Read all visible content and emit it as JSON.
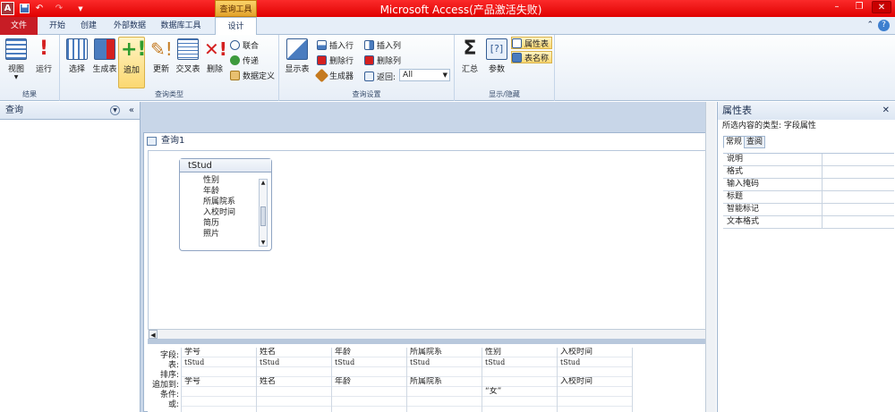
{
  "window": {
    "title": "Microsoft Access(产品激活失败)",
    "context_tab": "查询工具"
  },
  "quick_access": {
    "app_icon": "A",
    "save_icon": "save-icon",
    "undo_icon": "undo-icon",
    "redo_icon": "redo-icon",
    "more_icon": "chevron-down-icon"
  },
  "tabs": [
    {
      "label": "文件"
    },
    {
      "label": "开始"
    },
    {
      "label": "创建"
    },
    {
      "label": "外部数据"
    },
    {
      "label": "数据库工具"
    },
    {
      "label": "设计"
    }
  ],
  "ribbon": {
    "groups": {
      "results": "结果",
      "query_type": "查询类型",
      "query_setup": "查询设置",
      "show_hide": "显示/隐藏"
    },
    "buttons": {
      "view": "视图",
      "run": "运行",
      "select": "选择",
      "make_table": "生成表",
      "append": "追加",
      "update": "更新",
      "crosstab": "交叉表",
      "delete": "删除",
      "union": "联合",
      "pass_through": "传递",
      "data_definition": "数据定义",
      "show_table": "显示表",
      "insert_rows": "插入行",
      "delete_rows": "删除行",
      "builder": "生成器",
      "insert_columns": "插入列",
      "delete_columns": "删除列",
      "return_label": "返回:",
      "return_value": "All",
      "totals": "汇总",
      "parameters": "参数",
      "property_sheet": "属性表",
      "table_names": "表名称"
    }
  },
  "nav": {
    "title": "查询"
  },
  "query": {
    "tab_title": "查询1",
    "table": {
      "name": "tStud",
      "fields": [
        "性别",
        "年龄",
        "所属院系",
        "入校时间",
        "简历",
        "照片"
      ]
    },
    "row_labels": [
      "字段:",
      "表:",
      "排序:",
      "追加到:",
      "条件:",
      "或:"
    ],
    "columns": [
      {
        "field": "学号",
        "table": "tStud",
        "sort": "",
        "append_to": "学号",
        "criteria": ""
      },
      {
        "field": "姓名",
        "table": "tStud",
        "sort": "",
        "append_to": "姓名",
        "criteria": ""
      },
      {
        "field": "年龄",
        "table": "tStud",
        "sort": "",
        "append_to": "年龄",
        "criteria": ""
      },
      {
        "field": "所属院系",
        "table": "tStud",
        "sort": "",
        "append_to": "所属院系",
        "criteria": ""
      },
      {
        "field": "性别",
        "table": "tStud",
        "sort": "",
        "append_to": "",
        "criteria": "“女”"
      },
      {
        "field": "入校时间",
        "table": "tStud",
        "sort": "",
        "append_to": "入校时间",
        "criteria": ""
      }
    ]
  },
  "property_sheet": {
    "title": "属性表",
    "selection_type": "所选内容的类型: 字段属性",
    "tabs": [
      "常规",
      "查阅"
    ],
    "properties": [
      "说明",
      "格式",
      "输入掩码",
      "标题",
      "智能标记",
      "文本格式"
    ]
  },
  "colors": {
    "title_bar": "#e00000",
    "context_tab": "#f0b840",
    "ribbon_bg": "#e7eef7",
    "selected_button": "#fbd871"
  }
}
